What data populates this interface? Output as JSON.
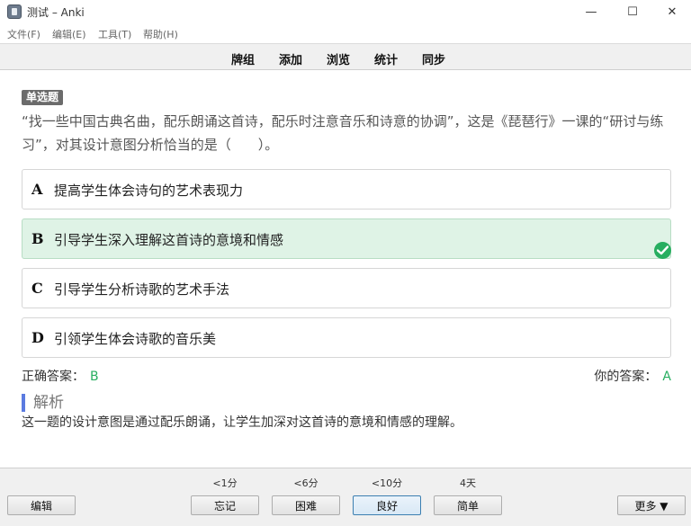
{
  "window": {
    "title": "测试 – Anki",
    "minimize_glyph": "—",
    "maximize_glyph": "☐",
    "close_glyph": "✕"
  },
  "menu": [
    "文件(F)",
    "编辑(E)",
    "工具(T)",
    "帮助(H)"
  ],
  "toolbar": [
    "牌组",
    "添加",
    "浏览",
    "统计",
    "同步"
  ],
  "card": {
    "question_type": "单选题",
    "question": "“找一些中国古典名曲，配乐朗诵这首诗，配乐时注意音乐和诗意的协调”，这是《琵琶行》一课的“研讨与练习”，对其设计意图分析恰当的是（　　）。",
    "options": [
      {
        "letter": "A",
        "text": "提高学生体会诗句的艺术表现力"
      },
      {
        "letter": "B",
        "text": "引导学生深入理解这首诗的意境和情感"
      },
      {
        "letter": "C",
        "text": "引导学生分析诗歌的艺术手法"
      },
      {
        "letter": "D",
        "text": "引领学生体会诗歌的音乐美"
      }
    ],
    "correct_label": "正确答案：",
    "correct_value": "B",
    "your_label": "你的答案：",
    "your_value": "A",
    "analysis_title": "解析",
    "analysis_text": "这一题的设计意图是通过配乐朗诵，让学生加深对这首诗的意境和情感的理解。",
    "accent_correct": "#27ae60",
    "accent_analysis": "#5b7be0"
  },
  "bottom": {
    "edit_label": "编辑",
    "more_label": "更多 ▼",
    "answers": [
      {
        "time": "<1分",
        "label": "忘记"
      },
      {
        "time": "<6分",
        "label": "困难"
      },
      {
        "time": "<10分",
        "label": "良好"
      },
      {
        "time": "4天",
        "label": "简单"
      }
    ]
  }
}
